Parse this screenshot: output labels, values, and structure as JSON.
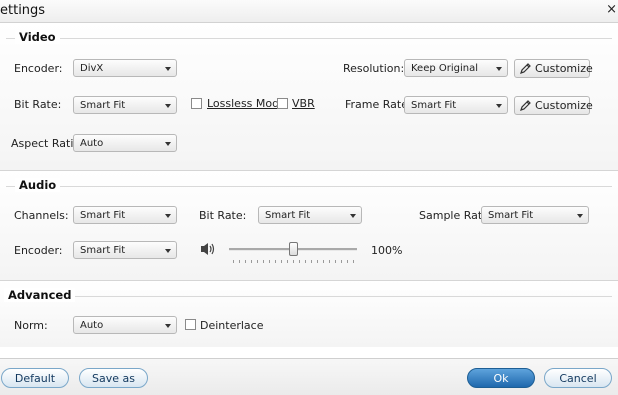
{
  "window": {
    "title": "ettings",
    "close_glyph": "×"
  },
  "video": {
    "section_title": "Video",
    "encoder": {
      "label": "Encoder:",
      "value": "DivX"
    },
    "bit_rate": {
      "label": "Bit Rate:",
      "value": "Smart Fit"
    },
    "aspect_ratio": {
      "label": "Aspect Ratio:",
      "value": "Auto"
    },
    "lossless_mode": {
      "label": "Lossless Mode",
      "checked": false
    },
    "vbr": {
      "label": "VBR",
      "checked": false
    },
    "resolution": {
      "label": "Resolution:",
      "value": "Keep Original",
      "customize_label": "Customize"
    },
    "frame_rate": {
      "label": "Frame Rate:",
      "value": "Smart Fit",
      "customize_label": "Customize"
    }
  },
  "audio": {
    "section_title": "Audio",
    "channels": {
      "label": "Channels:",
      "value": "Smart Fit"
    },
    "bit_rate": {
      "label": "Bit Rate:",
      "value": "Smart Fit"
    },
    "sample_rate": {
      "label": "Sample Rate:",
      "value": "Smart Fit"
    },
    "encoder": {
      "label": "Encoder:",
      "value": "Smart Fit"
    },
    "volume": {
      "level_percent": 100,
      "display": "100%"
    }
  },
  "advanced": {
    "section_title": "Advanced",
    "norm": {
      "label": "Norm:",
      "value": "Auto"
    },
    "deinterlace": {
      "label": "Deinterlace",
      "checked": false
    }
  },
  "footer": {
    "default_label": "Default",
    "save_as_label": "Save as",
    "ok_label": "Ok",
    "cancel_label": "Cancel"
  }
}
